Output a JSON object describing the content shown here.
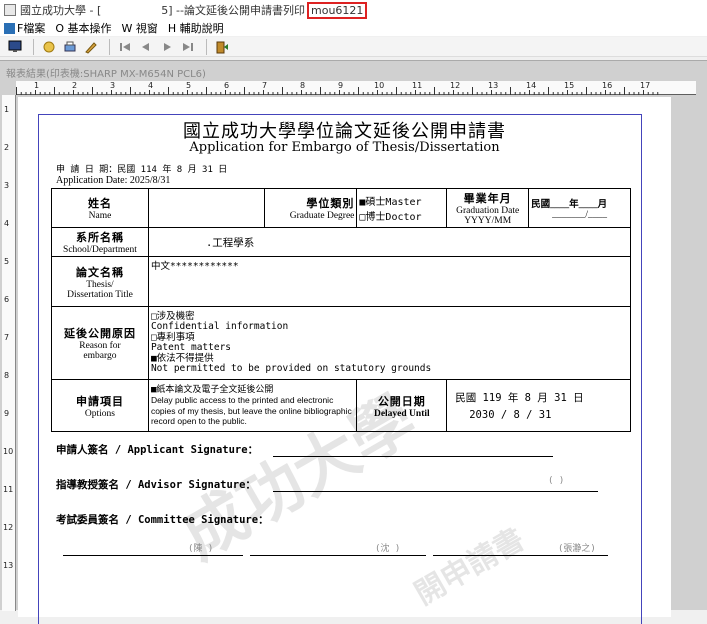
{
  "window": {
    "title_prefix": "國立成功大學 - [",
    "title_mid": "5] --論文延後公開申請書列印",
    "title_highlight": "mou6121"
  },
  "menu": [
    {
      "label": "F檔案",
      "icon": "file-icon"
    },
    {
      "label": "O 基本操作",
      "icon": "circle-icon"
    },
    {
      "label": "W 視窗",
      "icon": ""
    },
    {
      "label": "H 輔助說明",
      "icon": ""
    }
  ],
  "toolbar": {
    "buttons": [
      "display-icon",
      "magic-icon",
      "print-icon",
      "pen-icon",
      "first-page-icon",
      "prev-page-icon",
      "next-page-icon",
      "last-page-icon",
      "exit-icon"
    ]
  },
  "viewer": {
    "title": "報表結果(印表機:SHARP MX-M654N PCL6)",
    "ruler_top": [
      "1",
      "2",
      "3",
      "4",
      "5",
      "6",
      "7",
      "8",
      "9",
      "10",
      "11",
      "12",
      "13",
      "14",
      "15",
      "16",
      "17"
    ],
    "ruler_left": [
      "1",
      "2",
      "3",
      "4",
      "5",
      "6",
      "7",
      "8",
      "9",
      "10",
      "11",
      "12",
      "13"
    ]
  },
  "document": {
    "title": "國立成功大學學位論文延後公開申請書",
    "subtitle": "Application for Embargo of Thesis/Dissertation",
    "app_date_zh": "申 請 日 期：民國 114 年 8 月 31 日",
    "app_date_en": "Application Date: 2025/8/31",
    "name_zh": "姓名",
    "name_en": "Name",
    "name_value": "",
    "degree_zh": "學位類別",
    "degree_en": "Graduate Degree",
    "degree_master": "■碩士Master",
    "degree_doctor": "□博士Doctor",
    "grad_zh": "畢業年月",
    "grad_en": "Graduation Date",
    "grad_fmt": "YYYY/MM",
    "grad_value_line1": "民國____年____月",
    "grad_value_line2": "_______/____",
    "dept_zh": "系所名稱",
    "dept_en": "School/Department",
    "dept_value": ".工程學系",
    "thesis_zh": "論文名稱",
    "thesis_en1": "Thesis/",
    "thesis_en2": "Dissertation Title",
    "thesis_value": "中文************",
    "reason_zh": "延後公開原因",
    "reason_en1": "Reason for",
    "reason_en2": "embargo",
    "reasons": [
      "□涉及機密",
      "Confidential information",
      "□專利事項",
      "Patent matters",
      "■依法不得提供",
      "Not permitted to be provided on statutory grounds"
    ],
    "options_zh": "申請項目",
    "options_en": "Options",
    "option_check": "■紙本論文及電子全文延後公開",
    "option_desc": "Delay public access to the printed and electronic copies of my thesis, but leave the online bibliographic record open to the public.",
    "delay_zh": "公開日期",
    "delay_en": "Delayed Until",
    "delay_value1": "民國 119 年 8 月 31 日",
    "delay_value2": "2030 /  8 / 31",
    "applicant_sig": "申請人簽名 / Applicant Signature：",
    "advisor_sig": "指導教授簽名 / Advisor Signature：",
    "advisor_paren": "(      )",
    "committee_sig": "考試委員簽名 / Committee Signature：",
    "committee_1": "(陳    )",
    "committee_2": "(沈    )",
    "committee_3": "(張瀞之)",
    "watermark_main": "成功大學",
    "watermark_sub": "開申請書"
  }
}
